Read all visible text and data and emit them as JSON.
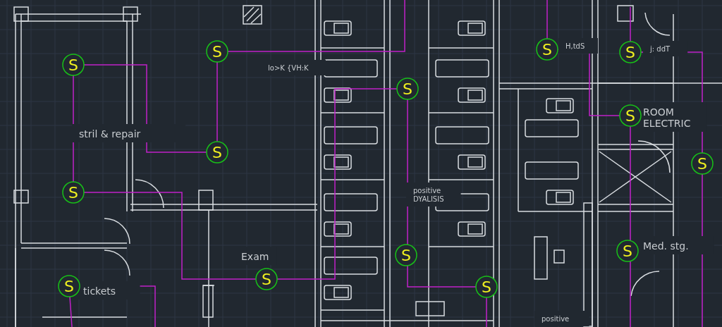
{
  "drawing": {
    "room_labels": [
      {
        "lines": [
          "stril & repair"
        ]
      },
      {
        "lines": [
          "lo>K {VH:K"
        ]
      },
      {
        "lines": [
          "positive",
          "DYALISIS"
        ]
      },
      {
        "lines": [
          "H,tdS"
        ]
      },
      {
        "lines": [
          "j: ddT"
        ]
      },
      {
        "lines": [
          "ROOM",
          "ELECTRIC"
        ]
      },
      {
        "lines": [
          "Med. stg."
        ]
      },
      {
        "lines": [
          "Exam"
        ]
      },
      {
        "lines": [
          "tickets"
        ]
      },
      {
        "lines": [
          "positive"
        ]
      }
    ],
    "sensors": [
      {
        "symbol": "S"
      },
      {
        "symbol": "S"
      },
      {
        "symbol": "S"
      },
      {
        "symbol": "S"
      },
      {
        "symbol": "S"
      },
      {
        "symbol": "S"
      },
      {
        "symbol": "S"
      },
      {
        "symbol": "S"
      },
      {
        "symbol": "S"
      },
      {
        "symbol": "S"
      },
      {
        "symbol": "S"
      },
      {
        "symbol": "S"
      },
      {
        "symbol": "S"
      },
      {
        "symbol": "S"
      }
    ]
  }
}
